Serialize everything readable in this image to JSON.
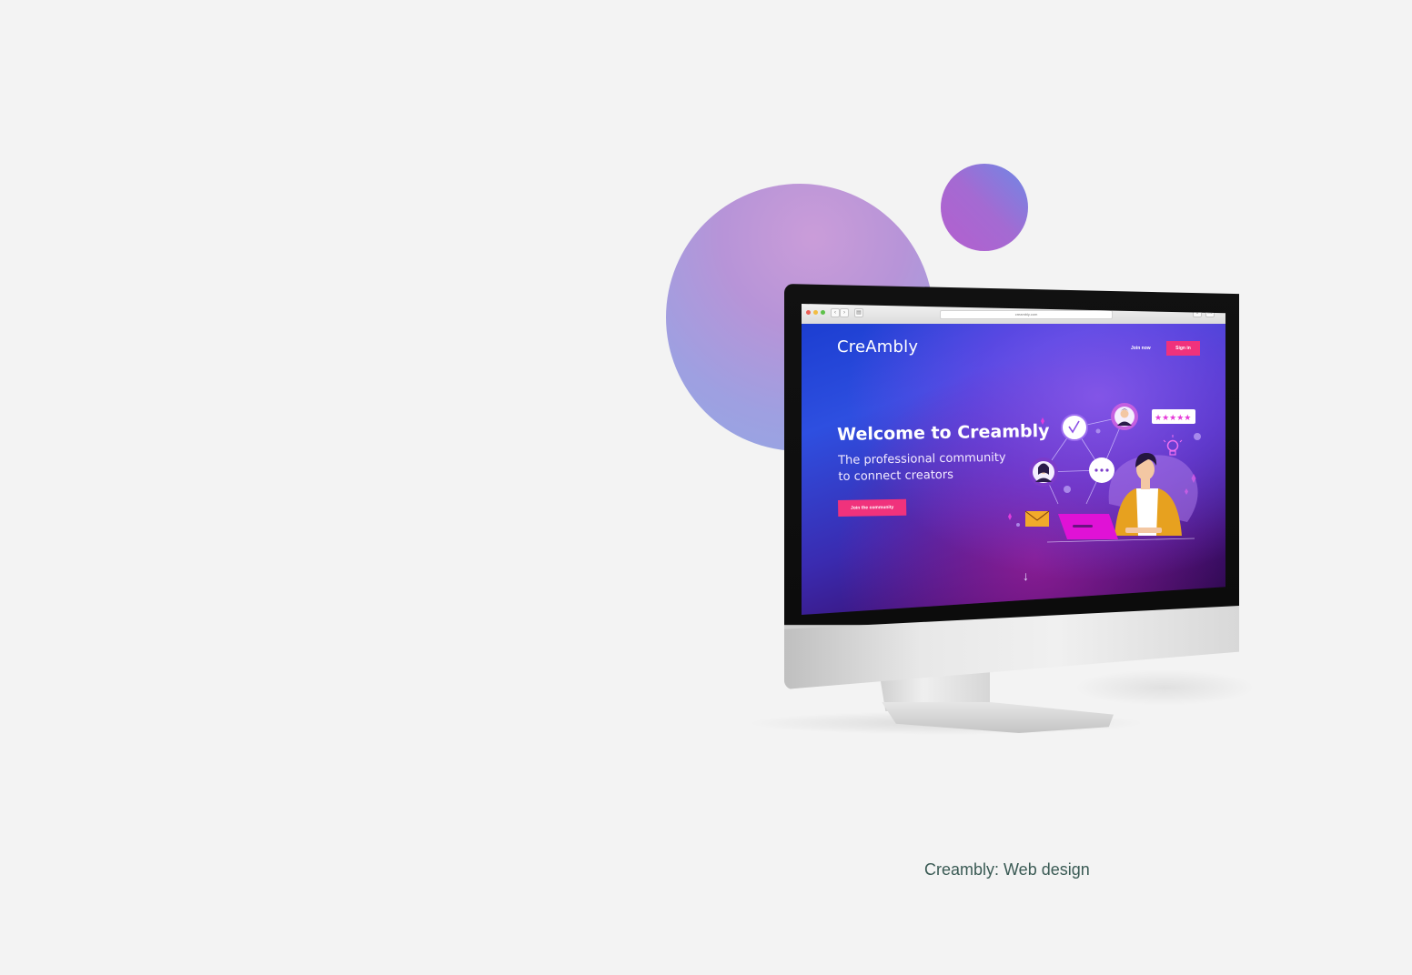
{
  "colors": {
    "page_background": "#f3f3f3",
    "accent_pink": "#f0327c",
    "caption_text": "#3a5a54",
    "hero_gradient_start": "#1c3ed1",
    "hero_gradient_end": "#2a0846"
  },
  "browser": {
    "address": "creambly.com"
  },
  "site": {
    "logo": "CreAmbly",
    "nav": {
      "join_now": "Join now",
      "sign_in": "Sign in"
    },
    "hero": {
      "title": "Welcome to Creambly",
      "subtitle_line1": "The professional community",
      "subtitle_line2": "to connect creators",
      "cta": "Join the community"
    },
    "illustration": {
      "rating_stars": 5,
      "icons": [
        "checkmark-icon",
        "avatar-icon",
        "avatar-icon",
        "chat-bubble-icon",
        "envelope-icon",
        "lightbulb-icon",
        "laptop-icon"
      ]
    },
    "scroll_indicator": "↓"
  },
  "caption": "Creambly: Web design"
}
